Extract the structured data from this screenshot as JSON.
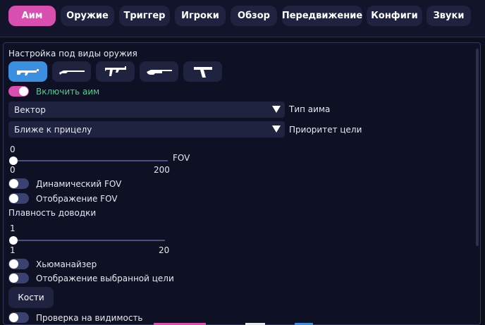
{
  "tabs": [
    {
      "label": "Аим",
      "active": true
    },
    {
      "label": "Оружие",
      "active": false
    },
    {
      "label": "Триггер",
      "active": false
    },
    {
      "label": "Игроки",
      "active": false
    },
    {
      "label": "Обзор",
      "active": false
    },
    {
      "label": "Передвижение",
      "active": false
    },
    {
      "label": "Конфиги",
      "active": false
    },
    {
      "label": "Звуки",
      "active": false
    }
  ],
  "aim": {
    "weapon_section_title": "Настройка под виды оружия",
    "weapon_icons": [
      "rifle-icon",
      "sniper-rifle-icon",
      "smg-icon",
      "shotgun-icon",
      "pistol-icon"
    ],
    "enable_aim": {
      "label": "Включить аим",
      "enabled": true
    },
    "aim_type": {
      "value": "Вектор",
      "label": "Тип аима"
    },
    "target_priority": {
      "value": "Ближе к прицелу",
      "label": "Приоритет цели"
    },
    "fov": {
      "label": "FOV",
      "value": "0",
      "min": "0",
      "max": "200"
    },
    "dynamic_fov": {
      "label": "Динамический FOV",
      "enabled": false
    },
    "show_fov": {
      "label": "Отображение FOV",
      "enabled": false
    },
    "smoothing": {
      "label": "Плавность доводки",
      "value": "1",
      "min": "1",
      "max": "20"
    },
    "humanizer": {
      "label": "Хьюманайзер",
      "enabled": false
    },
    "show_target": {
      "label": "Отображение выбранной цели",
      "enabled": false
    },
    "bones_button": "Кости",
    "visibility_check": {
      "label": "Проверка на видимость",
      "enabled": false
    }
  },
  "colors": {
    "accent": "#d94fb0",
    "selected_weapon": "#3a8fe0",
    "enabled_text": "#4fd18b"
  }
}
